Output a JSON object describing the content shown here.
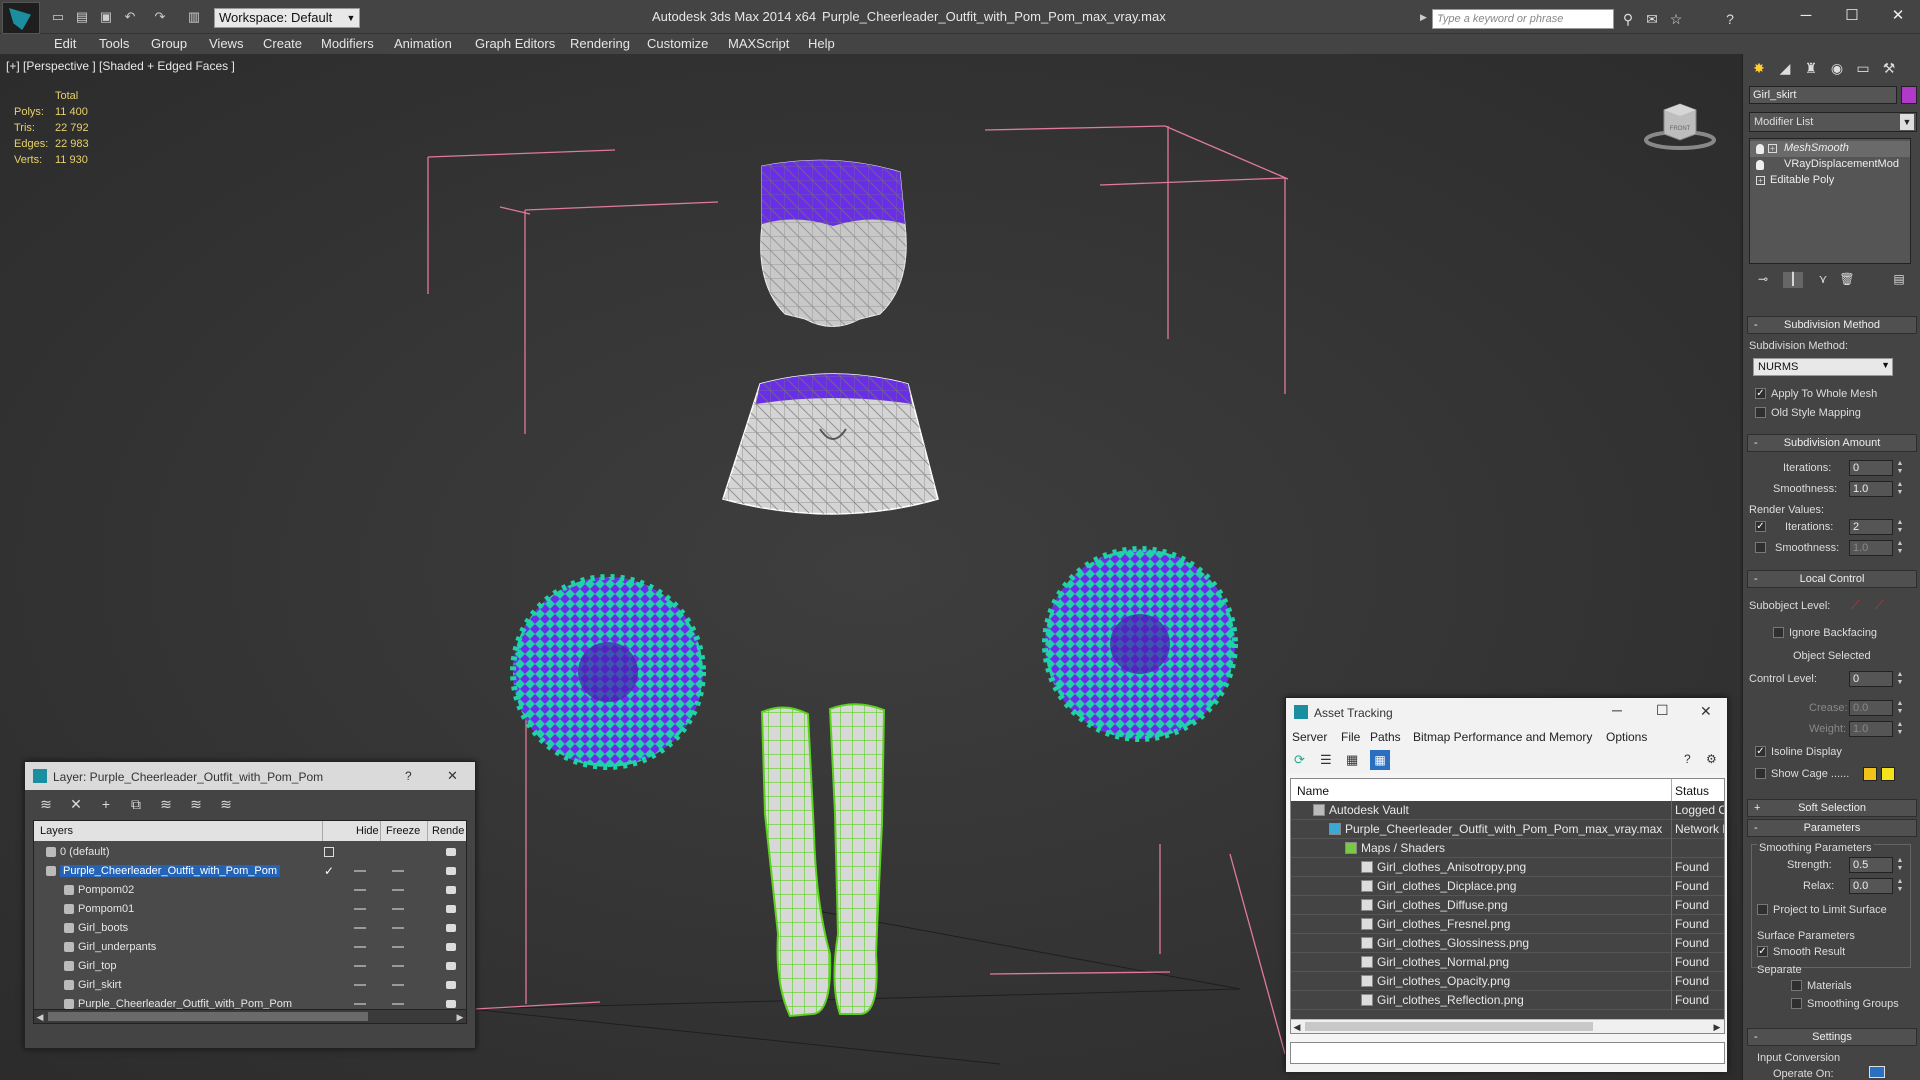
{
  "titlebar": {
    "workspace": "Workspace: Default",
    "app_title": "Autodesk 3ds Max  2014 x64",
    "file_title": "Purple_Cheerleader_Outfit_with_Pom_Pom_max_vray.max",
    "search_placeholder": "Type a keyword or phrase"
  },
  "menu": [
    "Edit",
    "Tools",
    "Group",
    "Views",
    "Create",
    "Modifiers",
    "Animation",
    "Graph Editors",
    "Rendering",
    "Customize",
    "MAXScript",
    "Help"
  ],
  "viewport": {
    "label": "[+] [Perspective ] [Shaded + Edged Faces ]",
    "stats": {
      "header": "Total",
      "rows": [
        {
          "key": "Polys:",
          "value": "11 400"
        },
        {
          "key": "Tris:",
          "value": "22 792"
        },
        {
          "key": "Edges:",
          "value": "22 983"
        },
        {
          "key": "Verts:",
          "value": "11 930"
        }
      ]
    },
    "viewcube_label": "FRONT",
    "colors": {
      "bbox": "#e07a9a",
      "purple": "#6a2ee8",
      "teal": "#1fd2a8",
      "mesh": "#d8d8d8",
      "green_wire": "#5ad21e"
    }
  },
  "layer_panel": {
    "title": "Layer: Purple_Cheerleader_Outfit_with_Pom_Pom",
    "help": "?",
    "close": "✕",
    "columns": [
      "Layers",
      "Hide",
      "Freeze",
      "Rende"
    ],
    "rows": [
      {
        "name": "0 (default)",
        "level": 0,
        "selected": false
      },
      {
        "name": "Purple_Cheerleader_Outfit_with_Pom_Pom",
        "level": 0,
        "selected": true
      },
      {
        "name": "Pompom02",
        "level": 1,
        "selected": false
      },
      {
        "name": "Pompom01",
        "level": 1,
        "selected": false
      },
      {
        "name": "Girl_boots",
        "level": 1,
        "selected": false
      },
      {
        "name": "Girl_underpants",
        "level": 1,
        "selected": false
      },
      {
        "name": "Girl_top",
        "level": 1,
        "selected": false
      },
      {
        "name": "Girl_skirt",
        "level": 1,
        "selected": false
      },
      {
        "name": "Purple_Cheerleader_Outfit_with_Pom_Pom",
        "level": 1,
        "selected": false
      }
    ]
  },
  "asset_panel": {
    "title": "Asset Tracking",
    "menu": [
      "Server",
      "File",
      "Paths",
      "Bitmap Performance and Memory",
      "Options"
    ],
    "columns": [
      "Name",
      "Status"
    ],
    "rows": [
      {
        "name": "Autodesk Vault",
        "status": "Logged O",
        "level": 0,
        "icon": "vault"
      },
      {
        "name": "Purple_Cheerleader_Outfit_with_Pom_Pom_max_vray.max",
        "status": "Network P",
        "level": 1,
        "icon": "max"
      },
      {
        "name": "Maps / Shaders",
        "status": "",
        "level": 2,
        "icon": "maps"
      },
      {
        "name": "Girl_clothes_Anisotropy.png",
        "status": "Found",
        "level": 3,
        "icon": "file"
      },
      {
        "name": "Girl_clothes_Dicplace.png",
        "status": "Found",
        "level": 3,
        "icon": "file"
      },
      {
        "name": "Girl_clothes_Diffuse.png",
        "status": "Found",
        "level": 3,
        "icon": "file"
      },
      {
        "name": "Girl_clothes_Fresnel.png",
        "status": "Found",
        "level": 3,
        "icon": "file"
      },
      {
        "name": "Girl_clothes_Glossiness.png",
        "status": "Found",
        "level": 3,
        "icon": "file"
      },
      {
        "name": "Girl_clothes_Normal.png",
        "status": "Found",
        "level": 3,
        "icon": "file"
      },
      {
        "name": "Girl_clothes_Opacity.png",
        "status": "Found",
        "level": 3,
        "icon": "file"
      },
      {
        "name": "Girl_clothes_Reflection.png",
        "status": "Found",
        "level": 3,
        "icon": "file"
      }
    ]
  },
  "command_panel": {
    "object_name": "Girl_skirt",
    "object_color": "#b039c9",
    "modifier_list": "Modifier List",
    "stack": [
      "MeshSmooth",
      "VRayDisplacementMod",
      "Editable Poly"
    ],
    "subdivision_method": {
      "title": "Subdivision Method",
      "label": "Subdivision Method:",
      "value": "NURMS",
      "apply_whole_mesh": "Apply To Whole Mesh",
      "old_style_mapping": "Old Style Mapping"
    },
    "subdivision_amount": {
      "title": "Subdivision Amount",
      "iterations_label": "Iterations:",
      "iterations": "0",
      "smoothness_label": "Smoothness:",
      "smoothness": "1.0",
      "render_values": "Render Values:",
      "render_iterations_label": "Iterations:",
      "render_iterations": "2",
      "render_smoothness_label": "Smoothness:",
      "render_smoothness": "1.0"
    },
    "local_control": {
      "title": "Local Control",
      "subobject_level": "Subobject Level:",
      "ignore_backfacing": "Ignore Backfacing",
      "object_selected": "Object Selected",
      "control_level_label": "Control Level:",
      "control_level": "0",
      "crease_label": "Crease:",
      "crease": "0.0",
      "weight_label": "Weight:",
      "weight": "1.0",
      "isoline_display": "Isoline Display",
      "show_cage": "Show Cage ......"
    },
    "soft_selection": "Soft Selection",
    "parameters": {
      "title": "Parameters",
      "smoothing_group": "Smoothing Parameters",
      "strength_label": "Strength:",
      "strength": "0.5",
      "relax_label": "Relax:",
      "relax": "0.0",
      "project_limit": "Project to Limit Surface",
      "surface_group": "Surface Parameters",
      "smooth_result": "Smooth Result",
      "separate": "Separate",
      "materials": "Materials",
      "smoothing_groups": "Smoothing Groups"
    },
    "settings": {
      "title": "Settings",
      "input_conversion": "Input Conversion",
      "operate_on": "Operate On:"
    }
  }
}
